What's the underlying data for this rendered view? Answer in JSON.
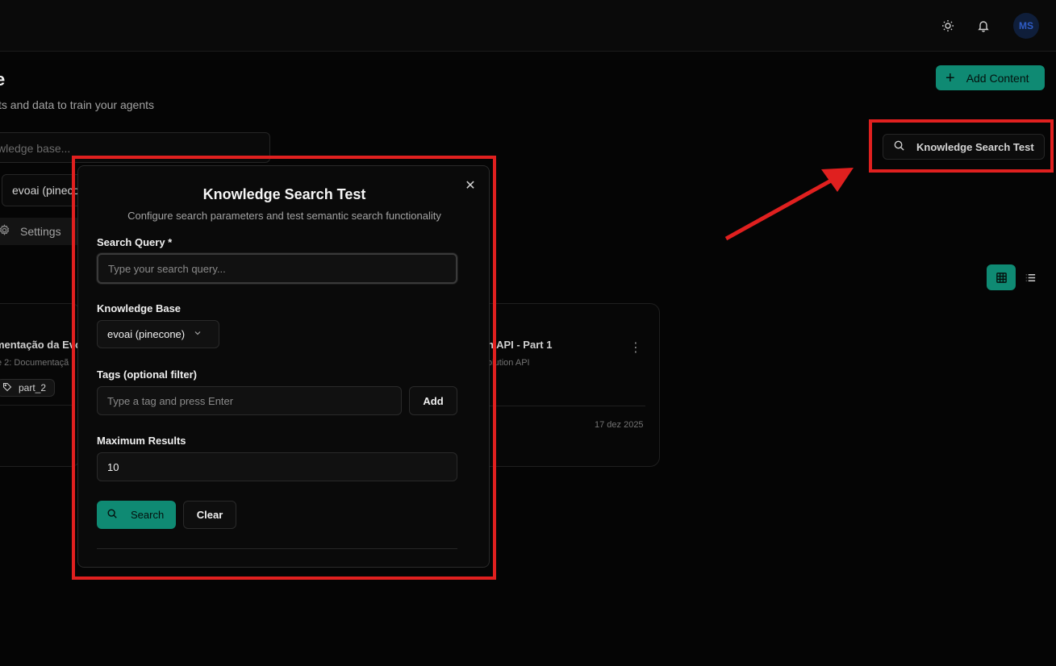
{
  "header": {
    "avatar_initials": "MS"
  },
  "page": {
    "title": "e",
    "subtitle": "ts and data to train your agents",
    "add_content_label": "Add Content",
    "kb_search_placeholder": "wledge base...",
    "kb_select_value": "evoai (pineco",
    "settings_label": "Settings",
    "knowledge_search_test_label": "Knowledge Search Test"
  },
  "cards": [
    {
      "title": "mentação da Evo",
      "subtitle": "e 2: Documentaçã",
      "tag": "part_2"
    },
    {
      "title": "n API - Part 1",
      "subtitle": "olution API",
      "date": "17 dez 2025"
    }
  ],
  "dialog": {
    "title": "Knowledge Search Test",
    "subtitle": "Configure search parameters and test semantic search functionality",
    "query_label": "Search Query *",
    "query_placeholder": "Type your search query...",
    "kb_label": "Knowledge Base",
    "kb_value": "evoai (pinecone)",
    "tags_label": "Tags (optional filter)",
    "tags_placeholder": "Type a tag and press Enter",
    "add_label": "Add",
    "max_label": "Maximum Results",
    "max_value": "10",
    "search_label": "Search",
    "clear_label": "Clear"
  },
  "colors": {
    "accent": "#0f8a73",
    "highlight": "#e0201f"
  }
}
